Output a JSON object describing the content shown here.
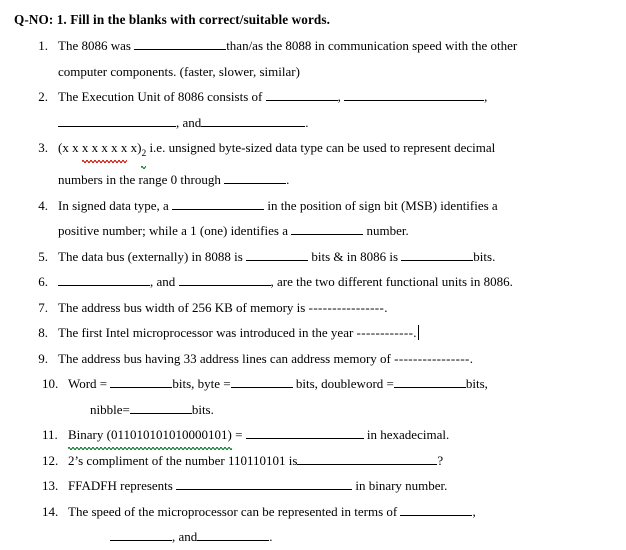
{
  "document": {
    "heading": "Q-NO: 1. Fill in the blanks with correct/suitable words.",
    "questions": [
      {
        "number": "1.",
        "line1_a": "The  8086  was",
        "line1_b": "than/as  the  8088  in  communication  speed  with  the  other",
        "line2": "computer components. (faster, slower, similar)"
      },
      {
        "number": "2.",
        "line1_a": "The   Execution   Unit   of   8086   consists   of",
        "line1_b": ",",
        "line1_c": ",",
        "line2_a": ",  and",
        "line2_b": "."
      },
      {
        "number": "3.",
        "paren_open": "(x x ",
        "x_underlined": "x x x x x",
        "paren_close": " x)",
        "subscript": "2",
        "line1_rest": " i.e.  unsigned  byte-sized  data  type  can  be  used  to  represent  decimal",
        "line2_a": "numbers in the range 0 through",
        "line2_b": "."
      },
      {
        "number": "4.",
        "line1_a": "In  signed  data  type,  a",
        "line1_b": "in  the  position  of  sign  bit  (MSB)  identifies  a",
        "line2_a": "positive number; while a 1 (one) identifies a",
        "line2_b": "number."
      },
      {
        "number": "5.",
        "line1_a": "The data bus (externally) in 8088 is",
        "line1_b": "bits & in 8086 is",
        "line1_c": "bits."
      },
      {
        "number": "6.",
        "line1_a": ", and",
        "line1_b": ", are the two different functional units in 8086."
      },
      {
        "number": "7.",
        "line1_a": "The address bus width of 256 KB of memory is ",
        "dashes": "----------------",
        "line1_b": "."
      },
      {
        "number": "8.",
        "line1_a": "The first Intel microprocessor was introduced in the year ",
        "dashes": "------------",
        "line1_b": ".",
        "has_caret": true
      },
      {
        "number": "9.",
        "line1_a": "The address bus having 33 address lines can address memory of ",
        "dashes": "----------------",
        "line1_b": "."
      },
      {
        "number": "10.",
        "line1_a": "Word = ",
        "line1_b": "bits, byte =",
        "line1_c": " bits, doubleword =",
        "line1_d": "bits,",
        "line2_a": "nibble=",
        "line2_b": "bits."
      },
      {
        "number": "11.",
        "line1_a": "Binary (011010101010000101)",
        "line1_b": " = ",
        "line1_c": " in hexadecimal."
      },
      {
        "number": "12.",
        "line1_a": "2’s compliment of the number 110110101 is",
        "line1_b": "?"
      },
      {
        "number": "13.",
        "line1_a": "FFADFH represents ",
        "line1_b": " in binary number."
      },
      {
        "number": "14.",
        "line1_a": "The   speed   of   the   microprocessor   can   be   represented   in   terms   of",
        "line1_b": ",",
        "line2_a": ",  and",
        "line2_b": "."
      }
    ]
  }
}
